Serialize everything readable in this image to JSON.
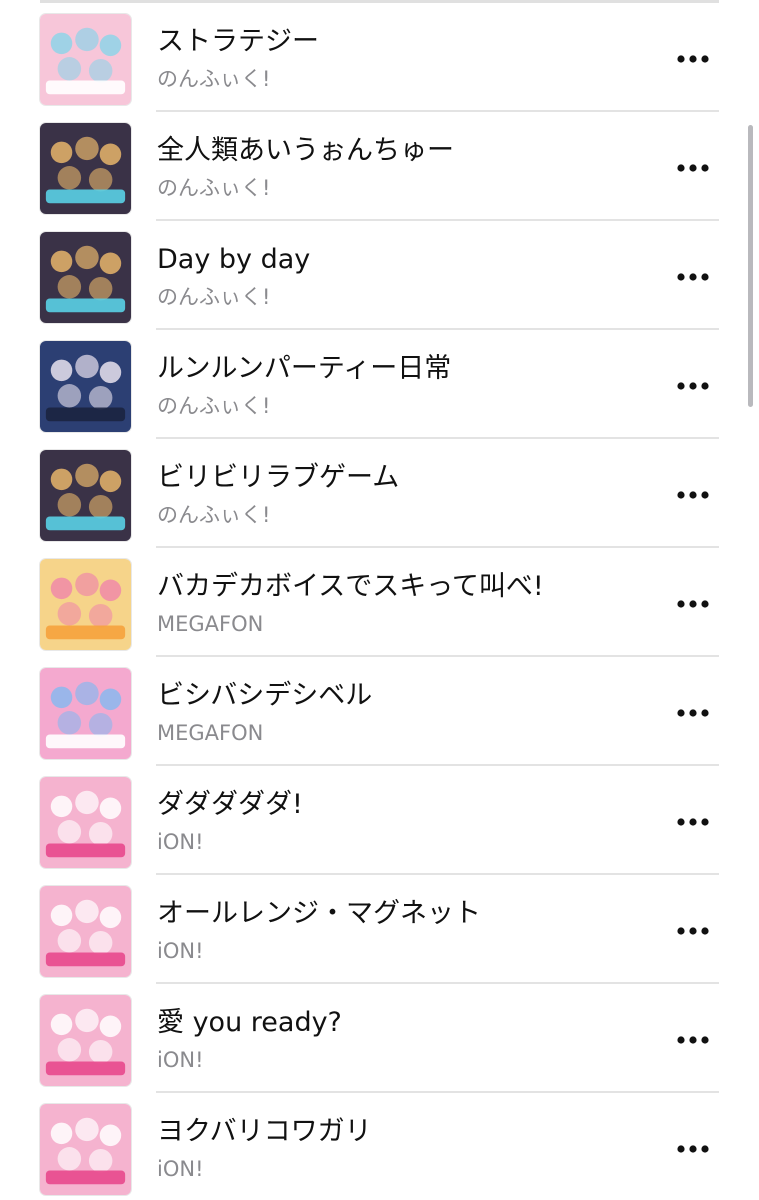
{
  "tracks": [
    {
      "title": "ストラテジー",
      "artist": "のんふぃく!",
      "artwork": {
        "bg": "#f7c6d9",
        "accent": "#8fd3e8",
        "band": "#ffffff"
      }
    },
    {
      "title": "全人類あいうぉんちゅー",
      "artist": "のんふぃく!",
      "artwork": {
        "bg": "#3a3247",
        "accent": "#e7b56b",
        "band": "#5ad0e6"
      }
    },
    {
      "title": "Day by day",
      "artist": "のんふぃく!",
      "artwork": {
        "bg": "#3a3247",
        "accent": "#e7b56b",
        "band": "#5ad0e6"
      }
    },
    {
      "title": "ルンルンパーティー日常",
      "artist": "のんふぃく!",
      "artwork": {
        "bg": "#2c3f73",
        "accent": "#e9e3ef",
        "band": "#1b2340"
      }
    },
    {
      "title": "ビリビリラブゲーム",
      "artist": "のんふぃく!",
      "artwork": {
        "bg": "#3a3247",
        "accent": "#e7b56b",
        "band": "#5ad0e6"
      }
    },
    {
      "title": "バカデカボイスでスキって叫べ!",
      "artist": "MEGAFON",
      "artwork": {
        "bg": "#f6d48a",
        "accent": "#f08aa8",
        "band": "#f6a23c"
      }
    },
    {
      "title": "ビシバシデシベル",
      "artist": "MEGAFON",
      "artwork": {
        "bg": "#f4a9cf",
        "accent": "#8ab8ee",
        "band": "#ffffff"
      }
    },
    {
      "title": "ダダダダダ!",
      "artist": "iON!",
      "artwork": {
        "bg": "#f5b3cf",
        "accent": "#ffffff",
        "band": "#e8488c"
      }
    },
    {
      "title": "オールレンジ・マグネット",
      "artist": "iON!",
      "artwork": {
        "bg": "#f5b3cf",
        "accent": "#ffffff",
        "band": "#e8488c"
      }
    },
    {
      "title": "愛 you ready?",
      "artist": "iON!",
      "artwork": {
        "bg": "#f5b3cf",
        "accent": "#ffffff",
        "band": "#e8488c"
      }
    },
    {
      "title": "ヨクバリコワガリ",
      "artist": "iON!",
      "artwork": {
        "bg": "#f5b3cf",
        "accent": "#ffffff",
        "band": "#e8488c"
      }
    }
  ],
  "icons": {
    "more": "ellipsis-icon"
  },
  "colors": {
    "title_text": "#111111",
    "artist_text": "#8a8a8e",
    "divider": "#e3e3e3",
    "scrollbar": "#b9b9bd"
  }
}
